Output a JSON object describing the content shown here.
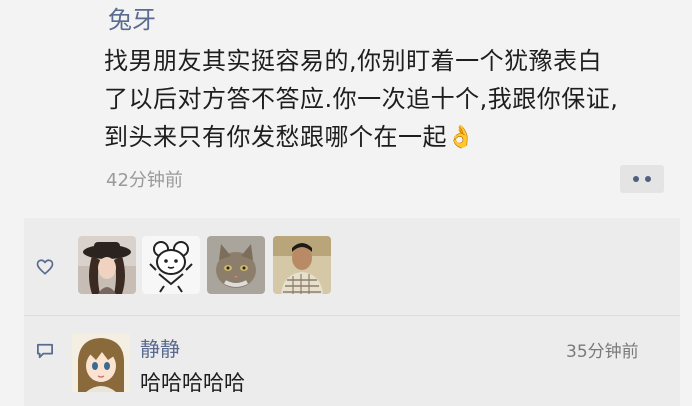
{
  "post": {
    "author": "兔牙",
    "text_lines": [
      "找男朋友其实挺容易的,你别盯着一个犹豫表白",
      "了以后对方答不答应.你一次追十个,我跟你保证,",
      "到头来只有你发愁跟哪个在一起"
    ],
    "emoji": "👌",
    "time": "42分钟前"
  },
  "likes": {
    "icon": "heart-outline",
    "avatars": [
      "woman-hat-photo",
      "cartoon-mouse-sticker",
      "cat-photo",
      "man-portrait-photo"
    ]
  },
  "comments": [
    {
      "name": "静静",
      "time": "35分钟前",
      "text": "哈哈哈哈哈",
      "avatar": "anime-girl-avatar"
    }
  ],
  "colors": {
    "name_link": "#5a6b8f",
    "background": "#f3f3f3",
    "panel": "#ececec",
    "muted_text": "#9a9a9a"
  }
}
